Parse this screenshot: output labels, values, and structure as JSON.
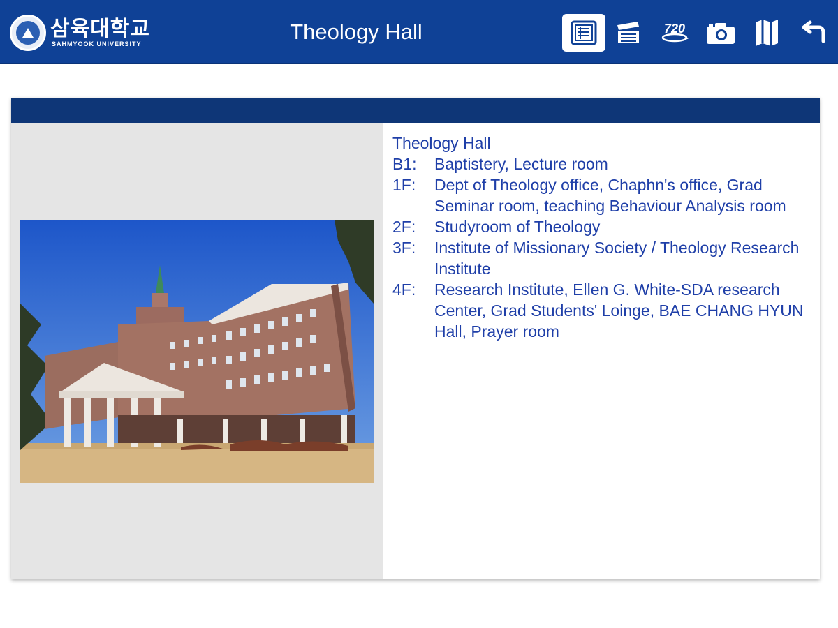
{
  "header": {
    "logo_korean": "삼육대학교",
    "logo_english": "SAHMYOOK UNIVERSITY",
    "title": "Theology Hall",
    "brand_color": "#0f4196",
    "toolbar": [
      {
        "icon": "info-panel-icon",
        "active": true
      },
      {
        "icon": "video-clapper-icon",
        "active": false
      },
      {
        "icon": "panorama-720-icon",
        "label": "720",
        "active": false
      },
      {
        "icon": "camera-icon",
        "active": false
      },
      {
        "icon": "map-icon",
        "active": false
      },
      {
        "icon": "back-arrow-icon",
        "active": false
      }
    ]
  },
  "content": {
    "bar_color": "#0e3677",
    "photo": {
      "icon": "building-photo"
    },
    "info": {
      "title": "Theology Hall",
      "text_color": "#1f3fa8",
      "floors": [
        {
          "label": "B1:",
          "text": "Baptistery, Lecture room"
        },
        {
          "label": "1F:",
          "text": "Dept of Theology office, Chaphn's office, Grad Seminar room, teaching Behaviour Analysis room"
        },
        {
          "label": "2F:",
          "text": "Studyroom of Theology"
        },
        {
          "label": "3F:",
          "text": "Institute of Missionary Society / Theology Research Institute"
        },
        {
          "label": "4F:",
          "text": "Research Institute, Ellen G. White-SDA research Center, Grad Students' Loinge, BAE CHANG HYUN Hall, Prayer room"
        }
      ]
    }
  }
}
